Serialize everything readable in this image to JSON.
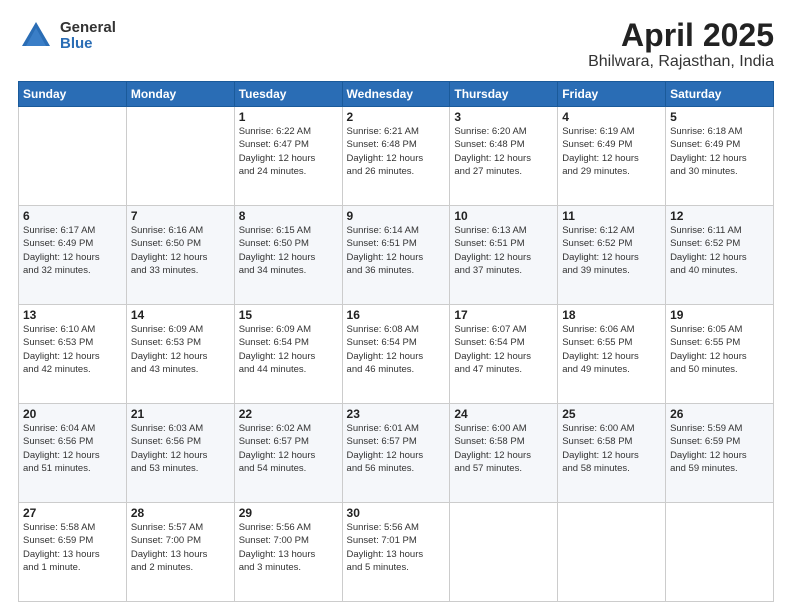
{
  "logo": {
    "general": "General",
    "blue": "Blue"
  },
  "title": "April 2025",
  "subtitle": "Bhilwara, Rajasthan, India",
  "days_header": [
    "Sunday",
    "Monday",
    "Tuesday",
    "Wednesday",
    "Thursday",
    "Friday",
    "Saturday"
  ],
  "weeks": [
    [
      {
        "day": "",
        "info": ""
      },
      {
        "day": "",
        "info": ""
      },
      {
        "day": "1",
        "info": "Sunrise: 6:22 AM\nSunset: 6:47 PM\nDaylight: 12 hours\nand 24 minutes."
      },
      {
        "day": "2",
        "info": "Sunrise: 6:21 AM\nSunset: 6:48 PM\nDaylight: 12 hours\nand 26 minutes."
      },
      {
        "day": "3",
        "info": "Sunrise: 6:20 AM\nSunset: 6:48 PM\nDaylight: 12 hours\nand 27 minutes."
      },
      {
        "day": "4",
        "info": "Sunrise: 6:19 AM\nSunset: 6:49 PM\nDaylight: 12 hours\nand 29 minutes."
      },
      {
        "day": "5",
        "info": "Sunrise: 6:18 AM\nSunset: 6:49 PM\nDaylight: 12 hours\nand 30 minutes."
      }
    ],
    [
      {
        "day": "6",
        "info": "Sunrise: 6:17 AM\nSunset: 6:49 PM\nDaylight: 12 hours\nand 32 minutes."
      },
      {
        "day": "7",
        "info": "Sunrise: 6:16 AM\nSunset: 6:50 PM\nDaylight: 12 hours\nand 33 minutes."
      },
      {
        "day": "8",
        "info": "Sunrise: 6:15 AM\nSunset: 6:50 PM\nDaylight: 12 hours\nand 34 minutes."
      },
      {
        "day": "9",
        "info": "Sunrise: 6:14 AM\nSunset: 6:51 PM\nDaylight: 12 hours\nand 36 minutes."
      },
      {
        "day": "10",
        "info": "Sunrise: 6:13 AM\nSunset: 6:51 PM\nDaylight: 12 hours\nand 37 minutes."
      },
      {
        "day": "11",
        "info": "Sunrise: 6:12 AM\nSunset: 6:52 PM\nDaylight: 12 hours\nand 39 minutes."
      },
      {
        "day": "12",
        "info": "Sunrise: 6:11 AM\nSunset: 6:52 PM\nDaylight: 12 hours\nand 40 minutes."
      }
    ],
    [
      {
        "day": "13",
        "info": "Sunrise: 6:10 AM\nSunset: 6:53 PM\nDaylight: 12 hours\nand 42 minutes."
      },
      {
        "day": "14",
        "info": "Sunrise: 6:09 AM\nSunset: 6:53 PM\nDaylight: 12 hours\nand 43 minutes."
      },
      {
        "day": "15",
        "info": "Sunrise: 6:09 AM\nSunset: 6:54 PM\nDaylight: 12 hours\nand 44 minutes."
      },
      {
        "day": "16",
        "info": "Sunrise: 6:08 AM\nSunset: 6:54 PM\nDaylight: 12 hours\nand 46 minutes."
      },
      {
        "day": "17",
        "info": "Sunrise: 6:07 AM\nSunset: 6:54 PM\nDaylight: 12 hours\nand 47 minutes."
      },
      {
        "day": "18",
        "info": "Sunrise: 6:06 AM\nSunset: 6:55 PM\nDaylight: 12 hours\nand 49 minutes."
      },
      {
        "day": "19",
        "info": "Sunrise: 6:05 AM\nSunset: 6:55 PM\nDaylight: 12 hours\nand 50 minutes."
      }
    ],
    [
      {
        "day": "20",
        "info": "Sunrise: 6:04 AM\nSunset: 6:56 PM\nDaylight: 12 hours\nand 51 minutes."
      },
      {
        "day": "21",
        "info": "Sunrise: 6:03 AM\nSunset: 6:56 PM\nDaylight: 12 hours\nand 53 minutes."
      },
      {
        "day": "22",
        "info": "Sunrise: 6:02 AM\nSunset: 6:57 PM\nDaylight: 12 hours\nand 54 minutes."
      },
      {
        "day": "23",
        "info": "Sunrise: 6:01 AM\nSunset: 6:57 PM\nDaylight: 12 hours\nand 56 minutes."
      },
      {
        "day": "24",
        "info": "Sunrise: 6:00 AM\nSunset: 6:58 PM\nDaylight: 12 hours\nand 57 minutes."
      },
      {
        "day": "25",
        "info": "Sunrise: 6:00 AM\nSunset: 6:58 PM\nDaylight: 12 hours\nand 58 minutes."
      },
      {
        "day": "26",
        "info": "Sunrise: 5:59 AM\nSunset: 6:59 PM\nDaylight: 12 hours\nand 59 minutes."
      }
    ],
    [
      {
        "day": "27",
        "info": "Sunrise: 5:58 AM\nSunset: 6:59 PM\nDaylight: 13 hours\nand 1 minute."
      },
      {
        "day": "28",
        "info": "Sunrise: 5:57 AM\nSunset: 7:00 PM\nDaylight: 13 hours\nand 2 minutes."
      },
      {
        "day": "29",
        "info": "Sunrise: 5:56 AM\nSunset: 7:00 PM\nDaylight: 13 hours\nand 3 minutes."
      },
      {
        "day": "30",
        "info": "Sunrise: 5:56 AM\nSunset: 7:01 PM\nDaylight: 13 hours\nand 5 minutes."
      },
      {
        "day": "",
        "info": ""
      },
      {
        "day": "",
        "info": ""
      },
      {
        "day": "",
        "info": ""
      }
    ]
  ]
}
